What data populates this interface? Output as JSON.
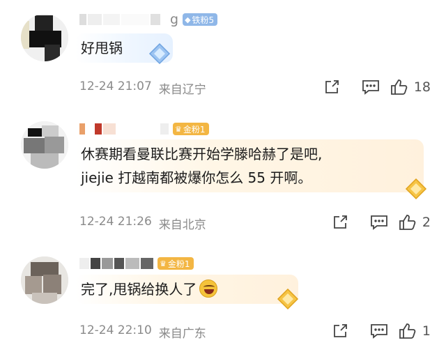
{
  "colors": {
    "meta_text": "#8a8a8a",
    "iron_badge": "#8fb7e8",
    "gold_badge": "#f3b643",
    "icon_stroke": "#444444"
  },
  "comments": [
    {
      "name_visible_suffix": "g",
      "badge": {
        "type": "iron",
        "icon": "diamond-icon",
        "label": "铁粉5"
      },
      "text_lines": [
        "好甩锅"
      ],
      "time": "12-24 21:07",
      "location": "来自辽宁",
      "likes": "18"
    },
    {
      "name_visible_suffix": "",
      "badge": {
        "type": "gold",
        "icon": "trophy-icon",
        "label": "金粉1"
      },
      "text_lines": [
        "休赛期看曼联比赛开始学滕哈赫了是吧,",
        "jiejie 打越南都被爆你怎么 55 开啊。"
      ],
      "time": "12-24 21:26",
      "location": "来自北京",
      "likes": "2"
    },
    {
      "name_visible_suffix": "",
      "badge": {
        "type": "gold",
        "icon": "trophy-icon",
        "label": "金粉1"
      },
      "text_lines": [
        "完了,甩锅给换人了"
      ],
      "emoji": "grinning-emoji",
      "time": "12-24 22:10",
      "location": "来自广东",
      "likes": "1"
    }
  ]
}
